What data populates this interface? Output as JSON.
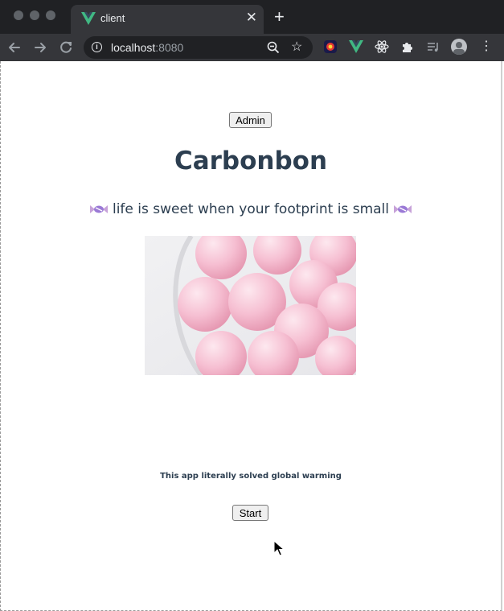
{
  "browser": {
    "tab_title": "client",
    "tab_close_glyph": "✕",
    "new_tab_glyph": "+",
    "url_host": "localhost",
    "url_port": ":8080",
    "icons": [
      "back-arrow-icon",
      "forward-arrow-icon",
      "reload-icon",
      "site-info-icon",
      "zoom-icon",
      "bookmark-star-icon",
      "extension-icon",
      "vue-devtools-icon",
      "react-devtools-icon",
      "puzzle-extensions-icon",
      "reading-list-icon",
      "profile-avatar",
      "more-menu-icon"
    ]
  },
  "page": {
    "admin_label": "Admin",
    "title": "Carbonbon",
    "tagline": "life is sweet when your footprint is small",
    "footnote": "This app literally solved global warming",
    "start_label": "Start"
  },
  "colors": {
    "chrome_dark": "#202124",
    "chrome_toolbar": "#35363a",
    "heading": "#2c3e50",
    "vue_green": "#41b883",
    "candy_pink": "#f7c6d6"
  }
}
